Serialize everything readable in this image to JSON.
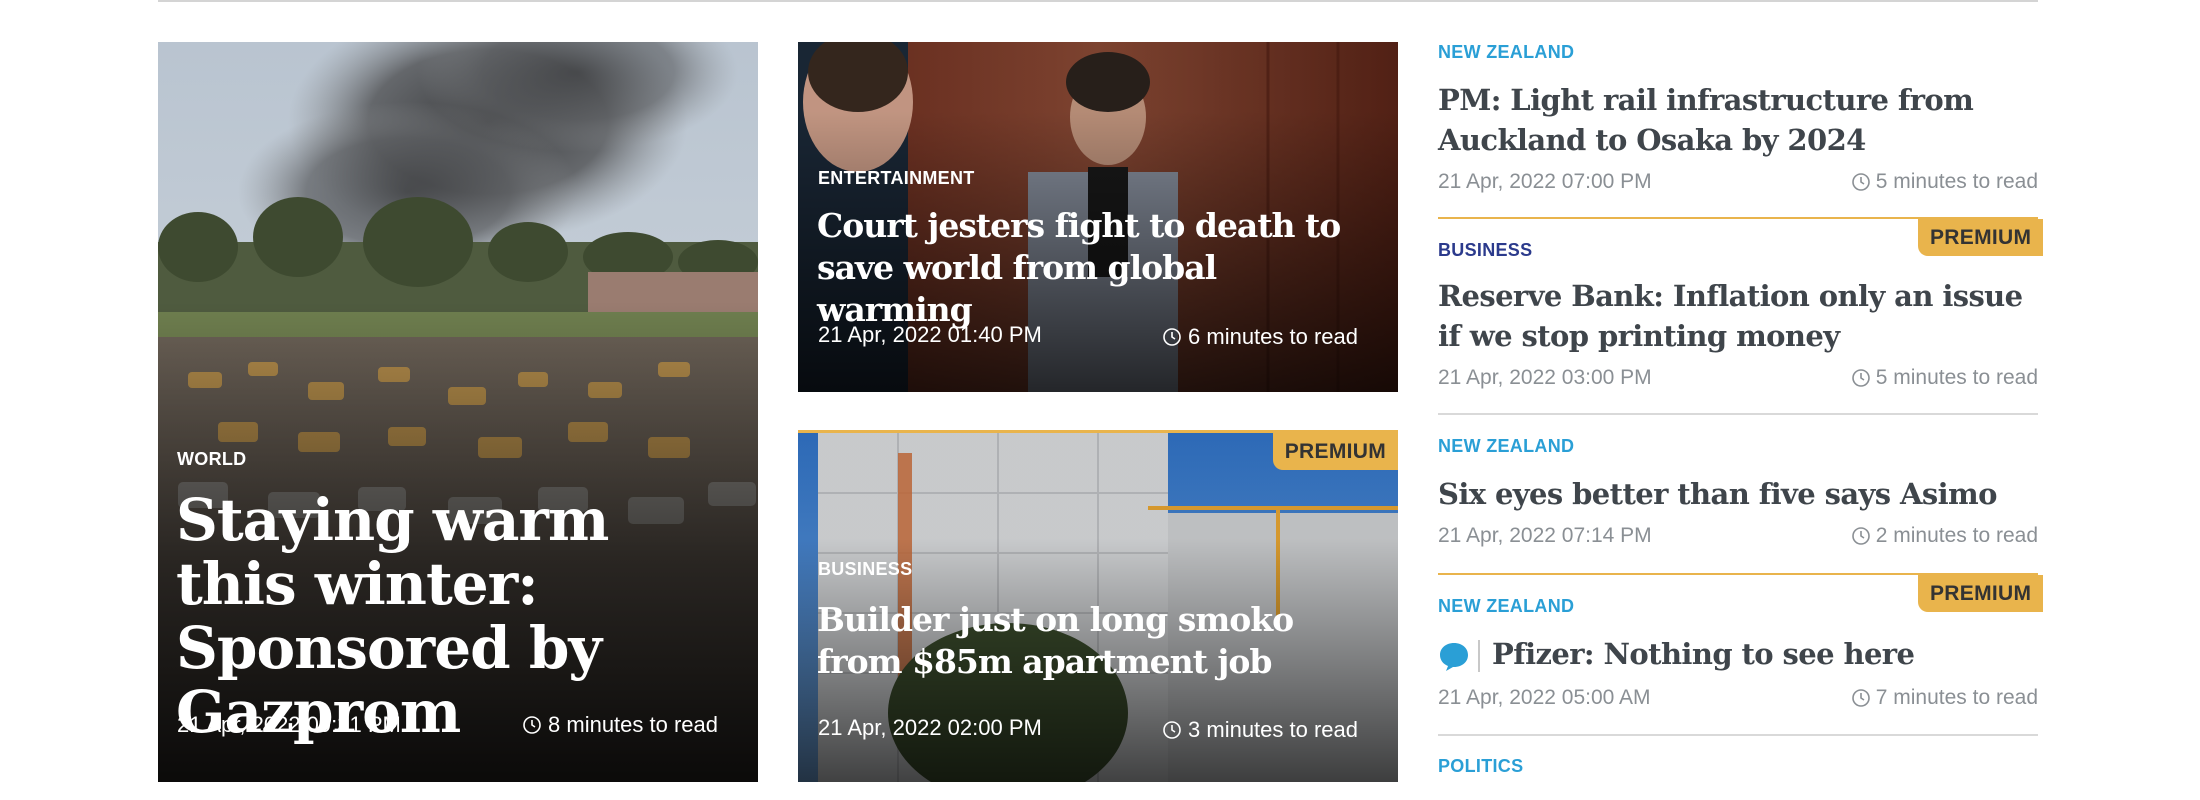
{
  "colors": {
    "premium": "#e9b44c",
    "category_nz": "#2a9fd6",
    "category_business": "#2b3a8c",
    "headline_dark": "#3f454b",
    "meta_gray": "#8a8f94"
  },
  "feature_cards": [
    {
      "category": "WORLD",
      "headline": "Staying warm this winter: Sponsored by Gazprom",
      "date": "21 Apr, 2022 09:31 PM",
      "read_time": "8 minutes to read",
      "image": "smoke over burned-out car park"
    },
    {
      "category": "ENTERTAINMENT",
      "headline": "Court jesters fight to death to save world from global warming",
      "date": "21 Apr, 2022 01:40 PM",
      "read_time": "6 minutes to read",
      "image": "man in grey suit in courtroom"
    },
    {
      "category": "BUSINESS",
      "headline": "Builder just on long smoko from $85m apartment job",
      "date": "21 Apr, 2022 02:00 PM",
      "read_time": "3 minutes to read",
      "premium_label": "PREMIUM",
      "image": "building under construction with crane"
    }
  ],
  "list": [
    {
      "category": "NEW ZEALAND",
      "title": "PM: Light rail infrastructure from Auckland to Osaka by 2024",
      "date": "21 Apr, 2022 07:00 PM",
      "read_time": "5 minutes to read"
    },
    {
      "category": "BUSINESS",
      "premium_label": "PREMIUM",
      "title": "Reserve Bank: Inflation only an issue if we stop printing money",
      "date": "21 Apr, 2022 03:00 PM",
      "read_time": "5 minutes to read"
    },
    {
      "category": "NEW ZEALAND",
      "title": "Six eyes better than five says Asimo",
      "date": "21 Apr, 2022 07:14 PM",
      "read_time": "2 minutes to read"
    },
    {
      "category": "NEW ZEALAND",
      "premium_label": "PREMIUM",
      "title": "Pfizer: Nothing to see here",
      "date": "21 Apr, 2022 05:00 AM",
      "read_time": "7 minutes to read",
      "icon": "comment-bubble-icon"
    },
    {
      "category": "POLITICS"
    }
  ]
}
